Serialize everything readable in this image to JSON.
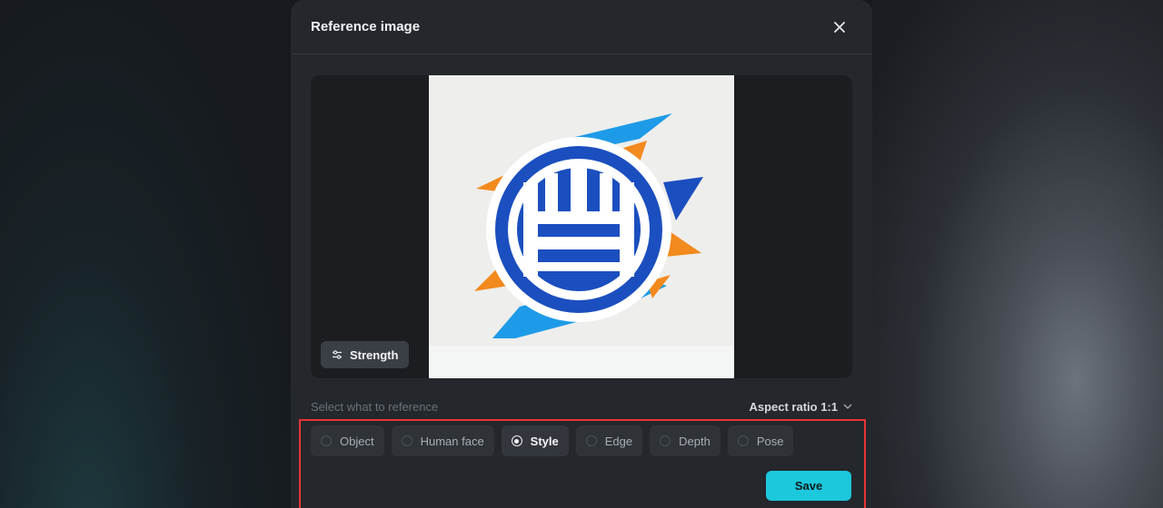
{
  "modal": {
    "title": "Reference image",
    "close_icon": "close-icon"
  },
  "preview": {
    "strength_label": "Strength",
    "strength_icon": "sliders-icon"
  },
  "reference": {
    "label": "Select what to reference",
    "aspect_ratio_label": "Aspect ratio 1:1",
    "aspect_icon": "chevron-down-icon"
  },
  "options": [
    {
      "label": "Object",
      "selected": false
    },
    {
      "label": "Human face",
      "selected": false
    },
    {
      "label": "Style",
      "selected": true
    },
    {
      "label": "Edge",
      "selected": false
    },
    {
      "label": "Depth",
      "selected": false
    },
    {
      "label": "Pose",
      "selected": false
    }
  ],
  "actions": {
    "save_label": "Save"
  },
  "colors": {
    "accent": "#1cc8dc",
    "highlight_border": "#e5343a",
    "logo_blue": "#1b4fbf",
    "logo_light_blue": "#1e9be8",
    "logo_orange": "#f28a1e"
  }
}
